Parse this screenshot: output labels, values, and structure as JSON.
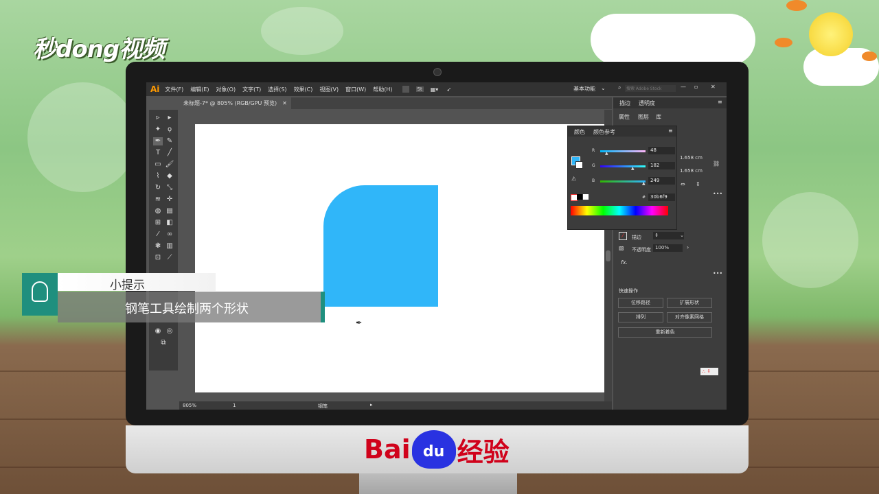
{
  "watermark": {
    "brand": "秒dong视频"
  },
  "app": {
    "logo": "Ai",
    "menu": [
      "文件(F)",
      "编辑(E)",
      "对象(O)",
      "文字(T)",
      "选择(S)",
      "效果(C)",
      "视图(V)",
      "窗口(W)",
      "帮助(H)"
    ],
    "st_label": "St",
    "workspace": "基本功能",
    "search_placeholder": "搜索 Adobe Stock",
    "doc_tab": "未标题-7* @ 805% (RGB/GPU 预览)",
    "zoom": "805%",
    "page": "1",
    "status": "钢笔"
  },
  "right_panel": {
    "tabs": [
      "描边",
      "透明度"
    ],
    "subtabs": [
      "属性",
      "图层",
      "库"
    ],
    "width": "1.658 cm",
    "height": "1.658 cm",
    "stroke_label": "描边",
    "opacity_label": "不透明度",
    "opacity_value": "100%",
    "fx": "fx.",
    "quick_actions": "快速操作",
    "btn_offset": "位移路径",
    "btn_expand": "扩展形状",
    "btn_arrange": "排列",
    "btn_align": "对齐像素网格",
    "btn_recolor": "重新着色"
  },
  "color_panel": {
    "tabs": [
      "颜色",
      "颜色参考"
    ],
    "r_label": "R",
    "g_label": "G",
    "b_label": "B",
    "r": "48",
    "g": "182",
    "b": "249",
    "hex_label": "#",
    "hex": "30b6f9",
    "fill_color": "#30b6f9"
  },
  "tip": {
    "title": "小提示",
    "text": "钢笔工具绘制两个形状"
  },
  "footer": {
    "baidu": "Bai",
    "du": "du",
    "jingyan": "经验"
  }
}
